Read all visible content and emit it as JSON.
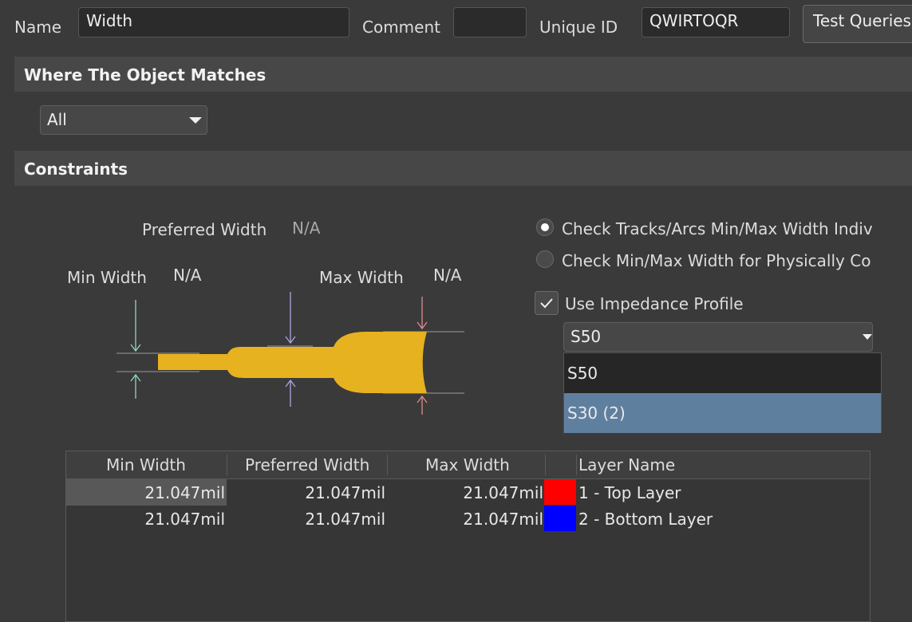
{
  "header": {
    "name_label": "Name",
    "name_value": "Width",
    "comment_label": "Comment",
    "comment_value": "",
    "unique_id_label": "Unique ID",
    "unique_id_value": "QWIRTOQR",
    "test_queries_label": "Test Queries"
  },
  "where_section": {
    "title": "Where The Object Matches",
    "scope_value": "All"
  },
  "constraints": {
    "title": "Constraints",
    "preferred_width_label": "Preferred Width",
    "preferred_width_value": "N/A",
    "min_width_label": "Min Width",
    "min_width_value": "N/A",
    "max_width_label": "Max Width",
    "max_width_value": "N/A",
    "radio_check_individual": "Check Tracks/Arcs Min/Max Width Indivi",
    "radio_check_physical": "Check Min/Max Width for Physically Cor",
    "radio_selected": "individual",
    "use_impedance_label": "Use Impedance Profile",
    "use_impedance_checked": true,
    "impedance_selected": "S50",
    "impedance_options": [
      "S50",
      "S30 (2)"
    ],
    "highlighted_option": "S30 (2)"
  },
  "table": {
    "columns": [
      "Min Width",
      "Preferred Width",
      "Max Width",
      "",
      "Layer Name"
    ],
    "rows": [
      {
        "min": "21.047mil",
        "preferred": "21.047mil",
        "max": "21.047mil",
        "color": "#ff0000",
        "layer": "1 - Top Layer"
      },
      {
        "min": "21.047mil",
        "preferred": "21.047mil",
        "max": "21.047mil",
        "color": "#0000ff",
        "layer": "2 - Bottom Layer"
      }
    ]
  },
  "colors": {
    "background": "#3a3a3a",
    "track": "#e6b21f",
    "min_arrow": "#8fd6c0",
    "pref_arrow": "#a8a8e0",
    "max_arrow": "#e08a8a",
    "highlight": "#5f7f9f"
  },
  "icons": [
    "chevron-down-icon",
    "checkmark-icon",
    "radio-dot-icon"
  ]
}
